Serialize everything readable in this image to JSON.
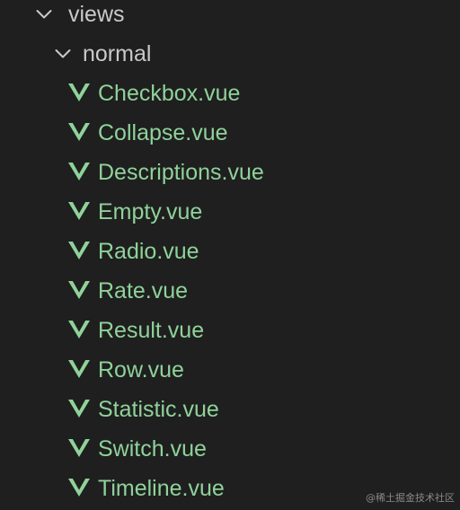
{
  "explorer": {
    "folders": [
      {
        "label": "views",
        "expanded": true
      },
      {
        "label": "normal",
        "expanded": true
      }
    ],
    "files": [
      {
        "label": "Checkbox.vue",
        "icon": "vue-icon"
      },
      {
        "label": "Collapse.vue",
        "icon": "vue-icon"
      },
      {
        "label": "Descriptions.vue",
        "icon": "vue-icon"
      },
      {
        "label": "Empty.vue",
        "icon": "vue-icon"
      },
      {
        "label": "Radio.vue",
        "icon": "vue-icon"
      },
      {
        "label": "Rate.vue",
        "icon": "vue-icon"
      },
      {
        "label": "Result.vue",
        "icon": "vue-icon"
      },
      {
        "label": "Row.vue",
        "icon": "vue-icon"
      },
      {
        "label": "Statistic.vue",
        "icon": "vue-icon"
      },
      {
        "label": "Switch.vue",
        "icon": "vue-icon"
      },
      {
        "label": "Timeline.vue",
        "icon": "vue-icon"
      }
    ]
  },
  "colors": {
    "background": "#1f1f1f",
    "folder_text": "#c9c9c9",
    "file_text": "#8fd29a",
    "vue_icon": "#8fd29a"
  },
  "watermark": "@稀土掘金技术社区"
}
